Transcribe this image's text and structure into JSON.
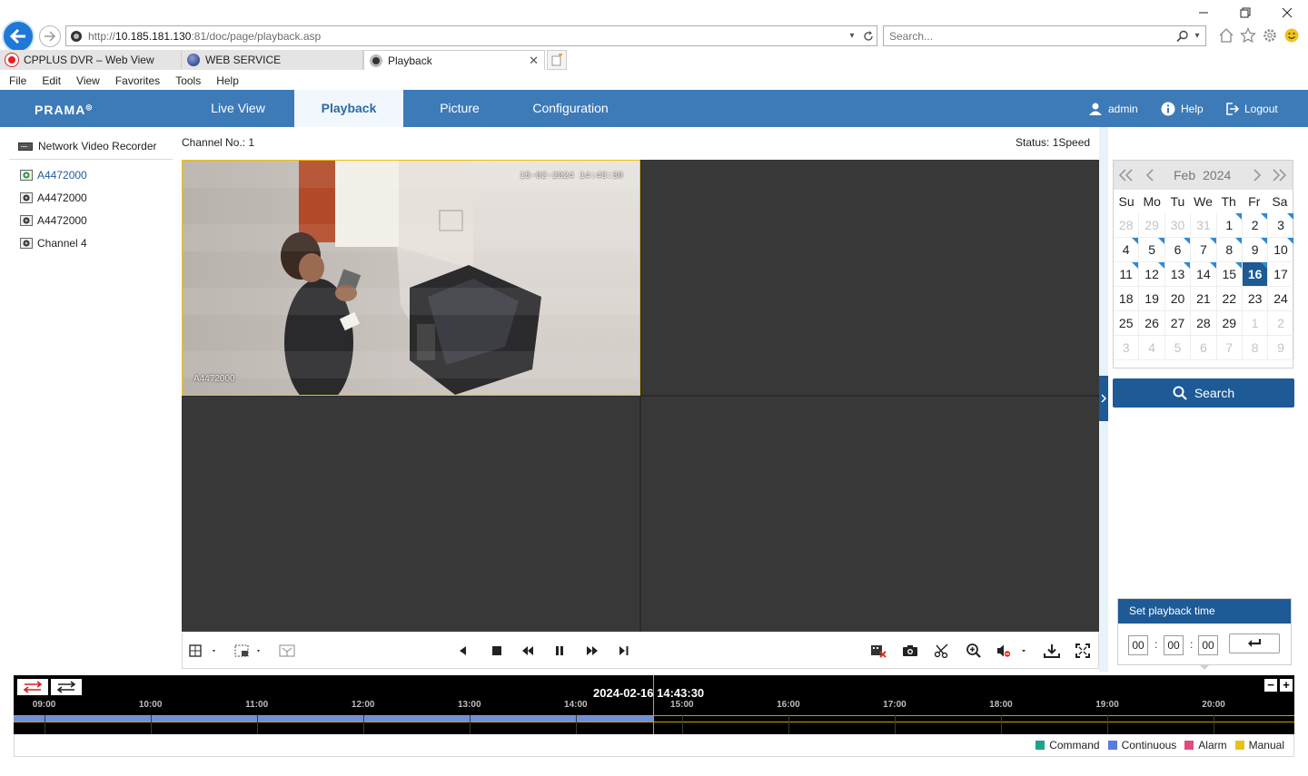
{
  "browser": {
    "url_prefix": "http://",
    "url_host": "10.185.181.130",
    "url_path": ":81/doc/page/playback.asp",
    "search_placeholder": "Search...",
    "tabs": [
      {
        "label": "CPPLUS DVR – Web View",
        "icon": "cpplus-favicon",
        "color": "#e02020"
      },
      {
        "label": "WEB SERVICE",
        "icon": "globe-favicon",
        "color": "#2a3f88"
      },
      {
        "label": "Playback",
        "icon": "camera-favicon",
        "color": "#333333",
        "active": true
      }
    ],
    "menu": [
      "File",
      "Edit",
      "View",
      "Favorites",
      "Tools",
      "Help"
    ]
  },
  "app": {
    "brand": "PRAMA",
    "nav": [
      {
        "label": "Live View"
      },
      {
        "label": "Playback",
        "active": true
      },
      {
        "label": "Picture"
      },
      {
        "label": "Configuration"
      }
    ],
    "user": "admin",
    "help": "Help",
    "logout": "Logout",
    "accent": "#3d7ab8",
    "dark_accent": "#1d5a96"
  },
  "tree": {
    "root": "Network Video Recorder",
    "channels": [
      {
        "label": "A4472000",
        "selected": true
      },
      {
        "label": "A4472000"
      },
      {
        "label": "A4472000"
      },
      {
        "label": "Channel 4"
      }
    ]
  },
  "player": {
    "channel_label": "Channel No.: 1",
    "status_label": "Status: 1Speed",
    "camera_timestamp": "15-02-2024 14:43:30",
    "camera_name": "A4472000"
  },
  "calendar": {
    "month": "Feb",
    "year": "2024",
    "dow": [
      "Su",
      "Mo",
      "Tu",
      "We",
      "Th",
      "Fr",
      "Sa"
    ],
    "days": [
      {
        "d": "28",
        "m": true
      },
      {
        "d": "29",
        "m": true
      },
      {
        "d": "30",
        "m": true
      },
      {
        "d": "31",
        "m": true
      },
      {
        "d": "1",
        "r": true
      },
      {
        "d": "2",
        "r": true
      },
      {
        "d": "3",
        "r": true
      },
      {
        "d": "4",
        "r": true
      },
      {
        "d": "5",
        "r": true
      },
      {
        "d": "6",
        "r": true
      },
      {
        "d": "7",
        "r": true
      },
      {
        "d": "8",
        "r": true
      },
      {
        "d": "9",
        "r": true
      },
      {
        "d": "10",
        "r": true
      },
      {
        "d": "11",
        "r": true
      },
      {
        "d": "12",
        "r": true
      },
      {
        "d": "13",
        "r": true
      },
      {
        "d": "14",
        "r": true
      },
      {
        "d": "15",
        "r": true
      },
      {
        "d": "16",
        "r": true,
        "t": true
      },
      {
        "d": "17"
      },
      {
        "d": "18"
      },
      {
        "d": "19"
      },
      {
        "d": "20"
      },
      {
        "d": "21"
      },
      {
        "d": "22"
      },
      {
        "d": "23"
      },
      {
        "d": "24"
      },
      {
        "d": "25"
      },
      {
        "d": "26"
      },
      {
        "d": "27"
      },
      {
        "d": "28"
      },
      {
        "d": "29"
      },
      {
        "d": "1",
        "m": true
      },
      {
        "d": "2",
        "m": true
      },
      {
        "d": "3",
        "m": true
      },
      {
        "d": "4",
        "m": true
      },
      {
        "d": "5",
        "m": true
      },
      {
        "d": "6",
        "m": true
      },
      {
        "d": "7",
        "m": true
      },
      {
        "d": "8",
        "m": true
      },
      {
        "d": "9",
        "m": true
      }
    ],
    "search_label": "Search"
  },
  "playback_time": {
    "title": "Set playback time",
    "hh": "00",
    "mm": "00",
    "ss": "00"
  },
  "timeline": {
    "current": "2024-02-16 14:43:30",
    "ticks": [
      "09:00",
      "10:00",
      "11:00",
      "12:00",
      "13:00",
      "14:00",
      "15:00",
      "16:00",
      "17:00",
      "18:00",
      "19:00",
      "20:00"
    ],
    "recorded_until_hour": 14.725,
    "cursor_hour": 14.725,
    "start_hour": 8.713,
    "end_hour": 20.76
  },
  "legend": [
    {
      "label": "Command",
      "color": "#1fa38a"
    },
    {
      "label": "Continuous",
      "color": "#5a7be0"
    },
    {
      "label": "Alarm",
      "color": "#e24a7a"
    },
    {
      "label": "Manual",
      "color": "#e8c21a"
    }
  ]
}
